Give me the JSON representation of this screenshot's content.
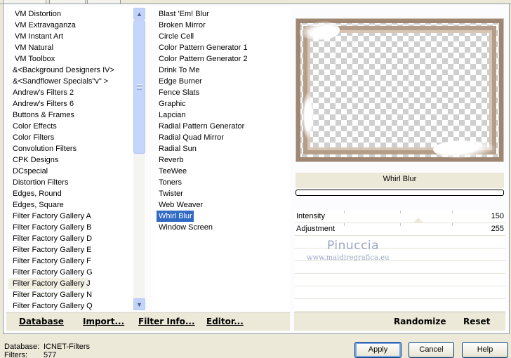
{
  "category_list": {
    "items": [
      "VM Distortion",
      "VM Extravaganza",
      "VM Instant Art",
      "VM Natural",
      "VM Toolbox",
      "&<Background Designers IV>",
      "&<Sandflower Specials\"v\" >",
      "Andrew's Filters 2",
      "Andrew's Filters 6",
      "Buttons & Frames",
      "Color Effects",
      "Color Filters",
      "Convolution Filters",
      "CPK Designs",
      "DCspecial",
      "Distortion Filters",
      "Edges, Round",
      "Edges, Square",
      "Filter Factory Gallery A",
      "Filter Factory Gallery B",
      "Filter Factory Gallery D",
      "Filter Factory Gallery E",
      "Filter Factory Gallery F",
      "Filter Factory Gallery G",
      "Filter Factory Gallery J",
      "Filter Factory Gallery N",
      "Filter Factory Gallery Q"
    ],
    "highlighted": "Filter Factory Gallery J"
  },
  "filter_list": {
    "items": [
      "Blast 'Em! Blur",
      "Broken Mirror",
      "Circle Cell",
      "Color Pattern Generator 1",
      "Color Pattern Generator 2",
      "Drink To Me",
      "Edge Burner",
      "Fence Slats",
      "Graphic",
      "Lapcian",
      "Radial Pattern Generator",
      "Radial Quad Mirror",
      "Radial Sun",
      "Reverb",
      "TeeWee",
      "Toners",
      "Twister",
      "Web Weaver",
      "Whirl Blur",
      "Window Screen"
    ],
    "selected": "Whirl Blur"
  },
  "preview": {
    "filter_title": "Whirl Blur",
    "progress": 0
  },
  "parameters": [
    {
      "label": "Intensity",
      "value": "150"
    },
    {
      "label": "Adjustment",
      "value": "255"
    }
  ],
  "watermark": {
    "name": "Pinuccia",
    "url": "www.maidiregrafica.eu"
  },
  "left_bar": {
    "database": "Database",
    "import": "Import...",
    "filter_info": "Filter Info...",
    "editor": "Editor..."
  },
  "right_bar": {
    "randomize": "Randomize",
    "reset": "Reset"
  },
  "status": {
    "database_label": "Database:",
    "database_value": "ICNET-Filters",
    "filters_label": "Filters:",
    "filters_value": "577"
  },
  "dialog_buttons": {
    "apply": "Apply",
    "cancel": "Cancel",
    "help": "Help"
  },
  "colors": {
    "selection": "#316ac5",
    "panel": "#ece9d8",
    "frame": "#b49d89",
    "watermark": "#9aa6c7"
  },
  "icons": {
    "scroll_up": "chevron-up-icon",
    "scroll_down": "chevron-down-icon"
  }
}
